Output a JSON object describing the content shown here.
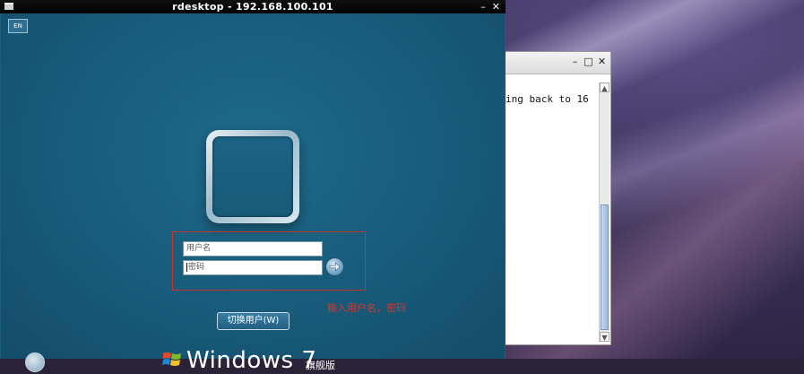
{
  "desktop": {},
  "terminal_window": {
    "controls": [
      "–",
      "□",
      "✕"
    ],
    "text": "ing back to 16"
  },
  "rdesktop_window": {
    "title": "rdesktop - 192.168.100.101",
    "controls": [
      "–",
      "✕"
    ]
  },
  "login_screen": {
    "language_button": "EN",
    "username_placeholder": "用户名",
    "password_placeholder": "密码",
    "annotation_text": "输入用户名，密码",
    "switch_user_button": "切换用户(W)",
    "branding": "Windows 7",
    "edition": "旗舰版",
    "annotation_color": "#c8342b",
    "background_color": "#1b5f7e"
  }
}
